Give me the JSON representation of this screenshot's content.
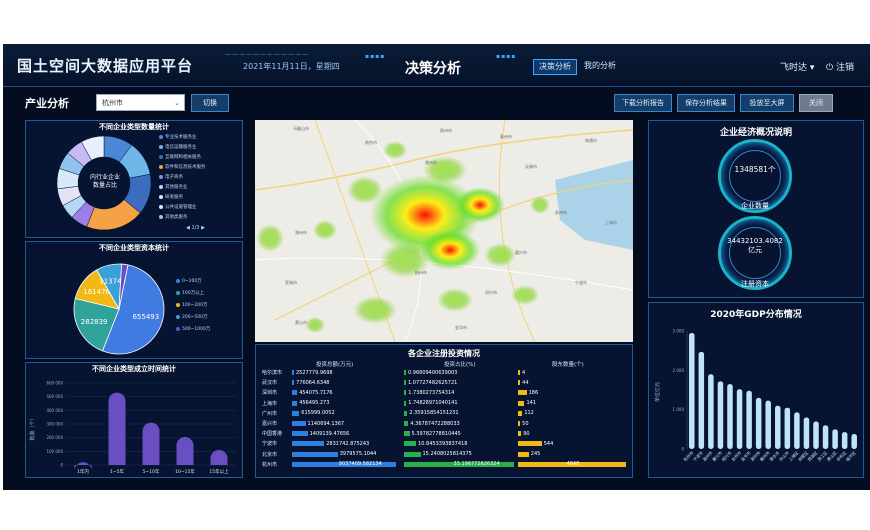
{
  "header": {
    "app_title": "国土空间大数据应用平台",
    "date": "2021年11月11日，星期四",
    "center_title": "决策分析",
    "tabs": [
      "决策分析",
      "我的分析"
    ],
    "active_tab": "决策分析",
    "user_name": "飞时达",
    "logout_label": "注销"
  },
  "toolbar": {
    "page_title": "产业分析",
    "city_value": "杭州市",
    "switch_label": "切换",
    "buttons": [
      "下载分析报告",
      "保存分析结果",
      "投放至大屏",
      "关闭"
    ]
  },
  "colors": {
    "page_bg": "#040d1f",
    "panel_border": "#1d5b9a",
    "accent": "#3ea6ff",
    "bar_blue": "#2f7fe0",
    "bar_green": "#2ab04a",
    "bar_yellow": "#f2b816",
    "column_purple": "#6a4fc2",
    "gdp_bar": "#bfe3f7"
  },
  "panels": {
    "type_count": {
      "title": "不同企业类型数量统计",
      "center_text": [
        "内行业企业",
        "数量占比"
      ],
      "legend": [
        "专业技术服务业",
        "电信运输服务业",
        "互联网和相关服务",
        "软件和信息技术服务",
        "电子商务",
        "其他服务业",
        "研发服务",
        "公共设施管理业",
        "其他类服务"
      ],
      "pager": "1/3",
      "chart_data": {
        "type": "pie",
        "values": [
          10,
          12,
          14,
          20,
          6,
          5,
          6,
          7,
          6,
          6,
          8
        ],
        "colors": [
          "#4b87d6",
          "#6fb6e8",
          "#3a6cc0",
          "#f5a145",
          "#9b7fe6",
          "#b5d7f3",
          "#e4e3f7",
          "#d8e9f9",
          "#8fc3ee",
          "#c9b9f5",
          "#e7f0fb"
        ]
      }
    },
    "capital": {
      "title": "不同企业类型资本统计",
      "legend": [
        "0~100万",
        "100万以上",
        "100~200万",
        "200~500万",
        "500~1000万"
      ],
      "chart_data": {
        "type": "pie",
        "values": [
          655493,
          282839,
          161476,
          113744,
          28000
        ],
        "labels": [
          "655493",
          "282839",
          "161476",
          "113744",
          ""
        ],
        "colors": [
          "#3f7be0",
          "#2fa39a",
          "#f2b816",
          "#3aa0d8",
          "#6a4fc2"
        ]
      }
    },
    "founding": {
      "title": "不同企业类型成立时间统计",
      "ylabel": "数量（个）",
      "chart_data": {
        "type": "bar",
        "categories": [
          "1年内",
          "1~5年",
          "5~10年",
          "10~15年",
          "15年以上"
        ],
        "values": [
          20000,
          530000,
          310000,
          205000,
          110000
        ],
        "yticks": [
          "0",
          "100 000",
          "200 000",
          "300 000",
          "400 000",
          "500 000",
          "600 000"
        ],
        "ylim": [
          0,
          600000
        ]
      }
    },
    "investment": {
      "title": "各企业注册投资情况",
      "col_headers": [
        "投资总额(万元)",
        "投资占比(%)",
        "股东数量(个)"
      ],
      "rows": [
        {
          "city": "哈尔滨市",
          "amount": "2527779.9698",
          "amount_frac": 0.01,
          "pct": "0.96809400639003",
          "pct_frac": 0.01,
          "holders": "4",
          "holders_frac": 0.0
        },
        {
          "city": "武汉市",
          "amount": "776064.6348",
          "amount_frac": 0.02,
          "pct": "1.07727482625721",
          "pct_frac": 0.01,
          "holders": "44",
          "holders_frac": 0.02
        },
        {
          "city": "深圳市",
          "amount": "454075.7176",
          "amount_frac": 0.05,
          "pct": "1.7380273754314",
          "pct_frac": 0.02,
          "holders": "186",
          "holders_frac": 0.08
        },
        {
          "city": "上海市",
          "amount": "456495.273",
          "amount_frac": 0.05,
          "pct": "1.74828971040141",
          "pct_frac": 0.02,
          "holders": "141",
          "holders_frac": 0.06
        },
        {
          "city": "广州市",
          "amount": "615999.0052",
          "amount_frac": 0.07,
          "pct": "2.35915854151231",
          "pct_frac": 0.03,
          "holders": "112",
          "holders_frac": 0.04
        },
        {
          "city": "嘉兴市",
          "amount": "1140694.1367",
          "amount_frac": 0.13,
          "pct": "4.36787472288033",
          "pct_frac": 0.04,
          "holders": "50",
          "holders_frac": 0.02
        },
        {
          "city": "中国香港",
          "amount": "1409139.47656",
          "amount_frac": 0.15,
          "pct": "5.39782778810445",
          "pct_frac": 0.05,
          "holders": "90",
          "holders_frac": 0.03
        },
        {
          "city": "宁波市",
          "amount": "2831742.875243",
          "amount_frac": 0.31,
          "pct": "10.8453393837418",
          "pct_frac": 0.11,
          "holders": "544",
          "holders_frac": 0.22
        },
        {
          "city": "北京市",
          "amount": "3979575.1044",
          "amount_frac": 0.44,
          "pct": "15.2408025814375",
          "pct_frac": 0.15,
          "holders": "245",
          "holders_frac": 0.1
        },
        {
          "city": "杭州市",
          "amount": "9037409.582134",
          "amount_frac": 1.0,
          "pct": "33.196772626324",
          "pct_frac": 1.0,
          "holders": "4848",
          "holders_frac": 1.0
        }
      ]
    },
    "economy": {
      "title": "企业经济概况说明",
      "count_value": "1348581个",
      "count_label": "企业数量",
      "capital_value": "34432103.4082亿元",
      "capital_label": "注册资本"
    },
    "gdp": {
      "title": "2020年GDP分布情况",
      "ylabel": "单位亿元",
      "chart_data": {
        "type": "bar",
        "categories": [
          "杭州市",
          "宁波市",
          "温州市",
          "嘉兴市",
          "绍兴市",
          "台州市",
          "金华市",
          "湖州市",
          "衢州市",
          "丽水市",
          "舟山市",
          "上城区",
          "拱墅区",
          "西湖区",
          "滨江区",
          "萧山区",
          "余杭区",
          "临平区"
        ],
        "values": [
          2950,
          2470,
          1900,
          1720,
          1650,
          1520,
          1480,
          1300,
          1230,
          1100,
          1050,
          930,
          800,
          700,
          600,
          500,
          430,
          380
        ],
        "yticks": [
          "0",
          "1 000",
          "2 000",
          "3 000"
        ],
        "ylim": [
          0,
          3000
        ]
      }
    },
    "map": {
      "labels": [
        "马鞍山市",
        "南京市",
        "扬州市",
        "泰州市",
        "南通市",
        "常州市",
        "无锡市",
        "苏州市",
        "上海市",
        "湖州市",
        "嘉兴市",
        "宣城市",
        "杭州市",
        "绍兴市",
        "宁波市",
        "黄山市",
        "金华市"
      ]
    }
  }
}
